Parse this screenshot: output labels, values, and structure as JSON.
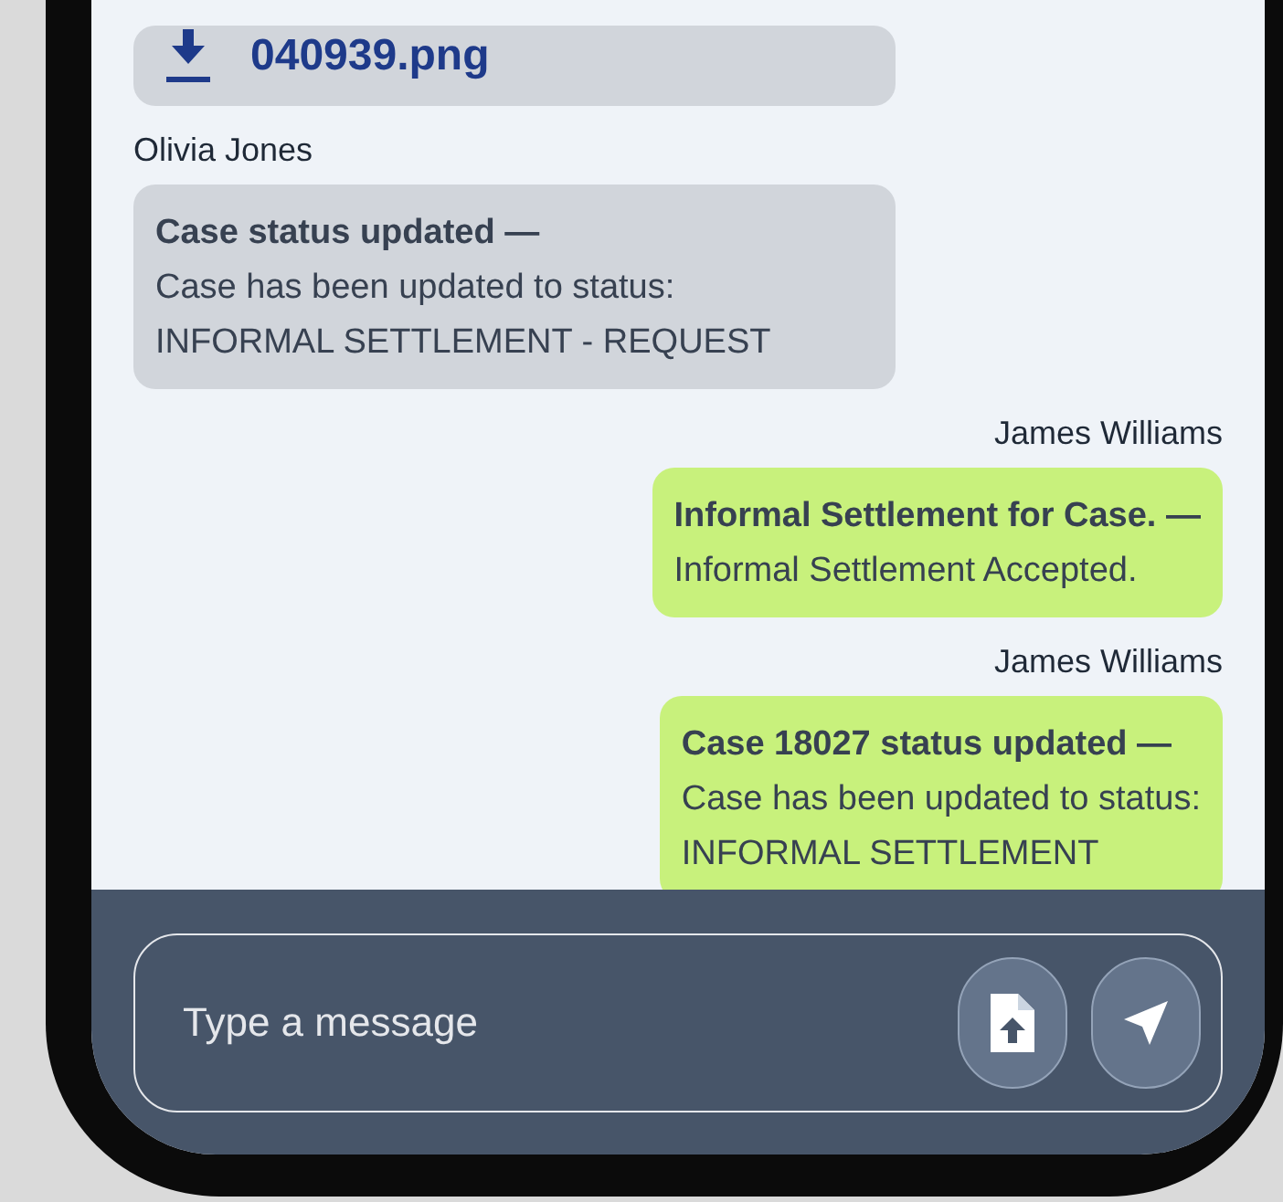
{
  "messages": [
    {
      "kind": "file",
      "outgoing": false,
      "file_name": "040939.png"
    },
    {
      "kind": "text",
      "outgoing": false,
      "sender": "Olivia Jones",
      "title": "Case status updated —",
      "lines": [
        "Case has been updated to status:",
        "INFORMAL SETTLEMENT - REQUEST"
      ]
    },
    {
      "kind": "text",
      "outgoing": true,
      "sender": "James Williams",
      "title": "Informal Settlement for Case. —",
      "lines": [
        "Informal Settlement Accepted."
      ]
    },
    {
      "kind": "text",
      "outgoing": true,
      "sender": "James Williams",
      "title": "Case 18027 status updated —",
      "lines": [
        "Case has been updated to status:",
        "INFORMAL SETTLEMENT"
      ]
    }
  ],
  "composer": {
    "placeholder": "Type a message"
  }
}
